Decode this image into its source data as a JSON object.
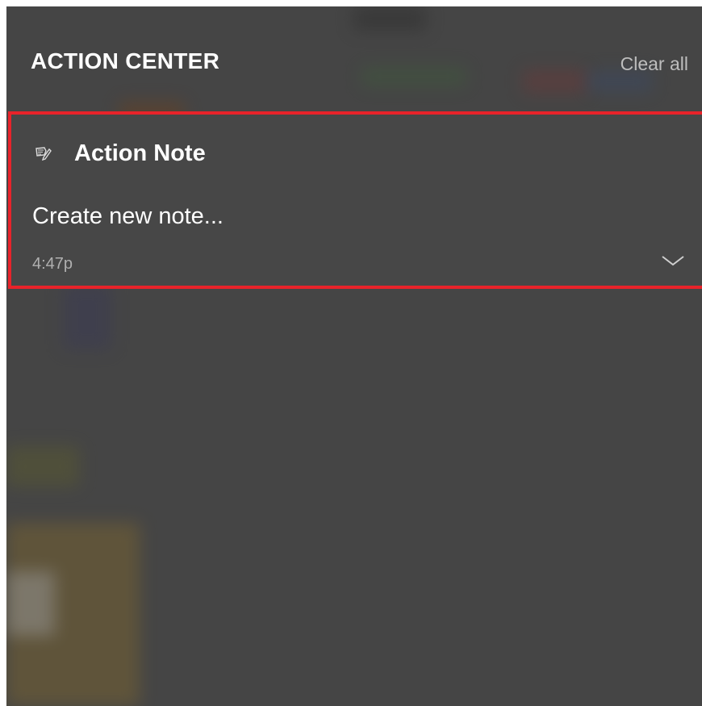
{
  "action_center": {
    "title": "ACTION CENTER",
    "clear_all_label": "Clear all"
  },
  "notification": {
    "app_icon": "note-pencil-icon",
    "app_name": "Action Note",
    "text": "Create new note...",
    "time": "4:47p",
    "expand_icon": "chevron-down-icon",
    "highlight_color": "#e8232a"
  },
  "colors": {
    "panel_background": "#454545",
    "title_text": "#ffffff",
    "secondary_text": "#b0b0b0"
  }
}
